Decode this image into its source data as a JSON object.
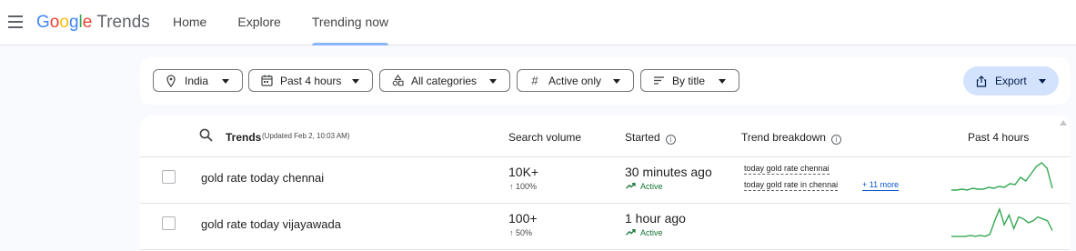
{
  "header": {
    "logo": {
      "google_letters": [
        {
          "char": "G",
          "color": "#4285F4"
        },
        {
          "char": "o",
          "color": "#EA4335"
        },
        {
          "char": "o",
          "color": "#FBBC05"
        },
        {
          "char": "g",
          "color": "#4285F4"
        },
        {
          "char": "l",
          "color": "#34A853"
        },
        {
          "char": "e",
          "color": "#EA4335"
        }
      ],
      "product": "Trends"
    },
    "nav": [
      {
        "label": "Home",
        "active": false
      },
      {
        "label": "Explore",
        "active": false
      },
      {
        "label": "Trending now",
        "active": true
      }
    ]
  },
  "filters": {
    "location": "India",
    "time_range": "Past 4 hours",
    "category": "All categories",
    "status": "Active only",
    "sort": "By title",
    "export": "Export"
  },
  "table": {
    "headers": {
      "trends": "Trends",
      "updated": "(Updated Feb 2, 10:03 AM)",
      "search_volume": "Search volume",
      "started": "Started",
      "breakdown": "Trend breakdown",
      "chart": "Past 4 hours"
    },
    "rows": [
      {
        "title": "gold rate today chennai",
        "volume": "10K+",
        "volume_change": "↑ 100%",
        "started": "30 minutes ago",
        "status": "Active",
        "breakdown": [
          "today gold rate chennai",
          "today gold rate in chennai"
        ],
        "more": "+ 11 more",
        "spark": [
          2,
          2,
          3,
          2,
          4,
          3,
          3,
          5,
          4,
          6,
          5,
          9,
          8,
          16,
          12,
          20,
          28,
          32,
          26,
          4
        ]
      },
      {
        "title": "gold rate today vijayawada",
        "volume": "100+",
        "volume_change": "↑ 50%",
        "started": "1 hour ago",
        "status": "Active",
        "breakdown": [],
        "more": "",
        "spark": [
          2,
          2,
          2,
          2,
          3,
          2,
          3,
          2,
          4,
          18,
          30,
          14,
          24,
          10,
          22,
          20,
          16,
          18,
          22,
          20,
          18,
          8
        ]
      }
    ]
  },
  "colors": {
    "accent": "#8ab4f8",
    "status_green": "#137333",
    "spark_green": "#34A853",
    "link_blue": "#0b57d0",
    "export_bg": "#d3e3fd"
  }
}
